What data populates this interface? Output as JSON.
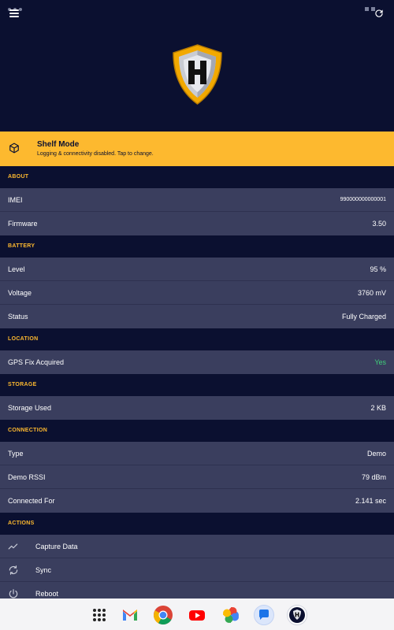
{
  "shelf": {
    "title": "Shelf Mode",
    "subtitle": "Logging & connectivity disabled. Tap to change."
  },
  "about": {
    "header": "ABOUT",
    "imei_label": "IMEI",
    "imei_value": "990000000000001",
    "firmware_label": "Firmware",
    "firmware_value": "3.50"
  },
  "battery": {
    "header": "BATTERY",
    "level_label": "Level",
    "level_value": "95 %",
    "voltage_label": "Voltage",
    "voltage_value": "3760 mV",
    "status_label": "Status",
    "status_value": "Fully Charged"
  },
  "location": {
    "header": "LOCATION",
    "gps_label": "GPS Fix Acquired",
    "gps_value": "Yes"
  },
  "storage": {
    "header": "STORAGE",
    "used_label": "Storage Used",
    "used_value": "2 KB"
  },
  "connection": {
    "header": "CONNECTION",
    "type_label": "Type",
    "type_value": "Demo",
    "rssi_label": "Demo RSSI",
    "rssi_value": "79 dBm",
    "connected_label": "Connected For",
    "connected_value": "2.141 sec"
  },
  "actions": {
    "header": "ACTIONS",
    "capture_label": "Capture Data",
    "sync_label": "Sync",
    "reboot_label": "Reboot"
  },
  "colors": {
    "background": "#0b1030",
    "row": "#3a3e5e",
    "accent": "#fdb92f",
    "success": "#3fd07a"
  },
  "dock": {
    "apps": [
      "app-drawer-icon",
      "gmail-icon",
      "chrome-icon",
      "youtube-icon",
      "photos-icon",
      "messages-icon",
      "hub-app-icon"
    ]
  }
}
